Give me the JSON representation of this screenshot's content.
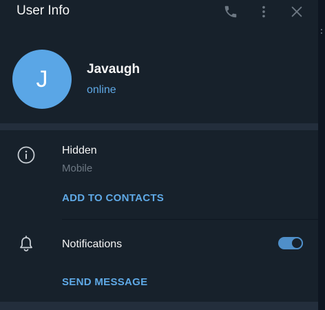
{
  "header": {
    "title": "User Info",
    "icons": [
      "phone-icon",
      "more-vertical-icon",
      "close-icon"
    ]
  },
  "profile": {
    "avatar_initial": "J",
    "avatar_color": "#5aa6e6",
    "name": "Javaugh",
    "status": "online"
  },
  "info": {
    "icon": "info-icon",
    "phone": "Hidden",
    "phone_label": "Mobile",
    "add_contacts_label": "ADD TO CONTACTS"
  },
  "notifications": {
    "icon": "bell-icon",
    "label": "Notifications",
    "enabled": true,
    "send_message_label": "SEND MESSAGE"
  },
  "colors": {
    "background": "#17212b",
    "accent": "#5fa9e6",
    "text_primary": "#f5f5f5",
    "text_secondary": "#6d7883"
  }
}
